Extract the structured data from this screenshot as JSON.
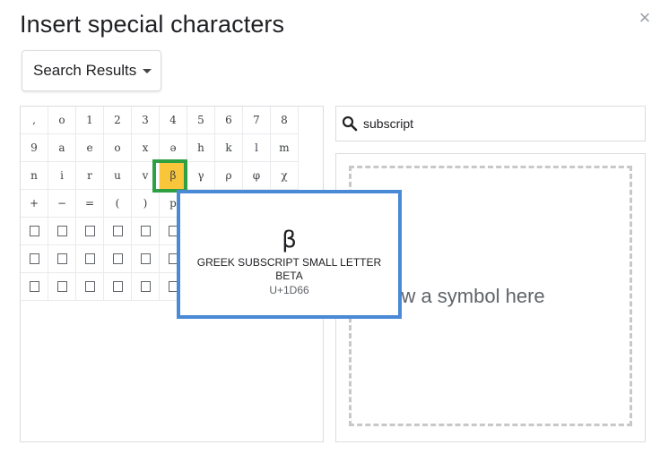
{
  "dialog": {
    "title": "Insert special characters",
    "close_label": "×"
  },
  "category": {
    "selected": "Search Results"
  },
  "search": {
    "value": "subscript",
    "placeholder": "subscript"
  },
  "grid": {
    "cells": [
      ",",
      "o",
      "1",
      "2",
      "3",
      "4",
      "5",
      "6",
      "7",
      "8",
      "9",
      "a",
      "e",
      "o",
      "x",
      "ə",
      "h",
      "k",
      "l",
      "m",
      "n",
      "i",
      "r",
      "u",
      "v",
      "β",
      "γ",
      "ρ",
      "φ",
      "χ",
      "+",
      "−",
      "=",
      "(",
      ")",
      "p",
      "",
      "",
      "",
      "",
      "",
      "",
      "",
      "",
      "",
      "",
      "",
      "",
      "",
      "",
      "",
      "",
      "",
      "",
      "",
      "",
      "",
      "",
      "",
      "",
      "",
      "",
      "",
      "",
      "",
      "",
      "",
      "",
      "",
      ""
    ],
    "selected_index": 25
  },
  "tooltip": {
    "char": "β",
    "name": "GREEK SUBSCRIPT SMALL LETTER BETA",
    "code": "U+1D66"
  },
  "draw": {
    "hint": "Draw a symbol here"
  },
  "colors": {
    "selected_cell": "#f9c53b",
    "selection_outline": "#2ea043",
    "tooltip_border": "#4a89d6"
  }
}
